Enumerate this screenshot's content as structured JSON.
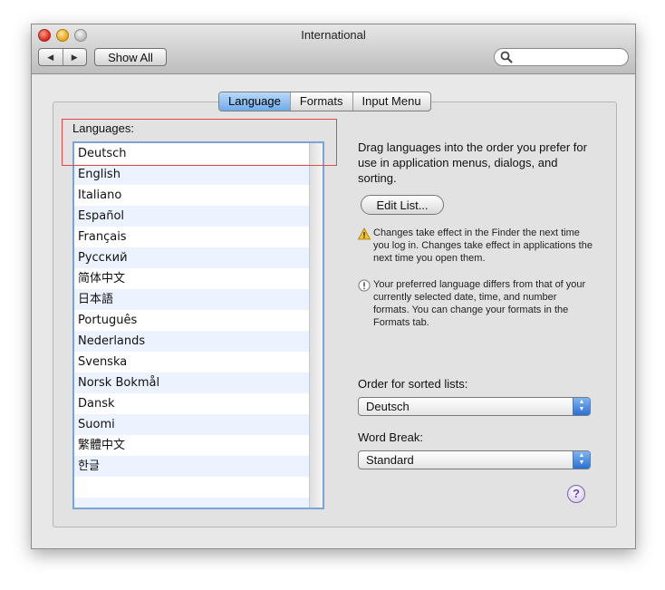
{
  "window": {
    "title": "International"
  },
  "toolbar": {
    "back_label": "◀",
    "forward_label": "▶",
    "show_all_label": "Show All",
    "search_value": "",
    "search_placeholder": ""
  },
  "tabs": [
    {
      "label": "Language",
      "active": true
    },
    {
      "label": "Formats",
      "active": false
    },
    {
      "label": "Input Menu",
      "active": false
    }
  ],
  "languages": {
    "label": "Languages:",
    "items": [
      "Deutsch",
      "English",
      "Italiano",
      "Español",
      "Français",
      "Русский",
      "简体中文",
      "日本語",
      "Português",
      "Nederlands",
      "Svenska",
      "Norsk Bokmål",
      "Dansk",
      "Suomi",
      "繁體中文",
      "한글"
    ]
  },
  "instructions": "Drag languages into the order you prefer for use in application menus, dialogs, and sorting.",
  "edit_list_label": "Edit List...",
  "notes": {
    "warning": "Changes take effect in the Finder the next time you log in. Changes take effect in applications the next time you open them.",
    "info": "Your preferred language differs from that of your currently selected date, time, and number formats. You can change your formats in the Formats tab."
  },
  "sort_order": {
    "label": "Order for sorted lists:",
    "value": "Deutsch"
  },
  "word_break": {
    "label": "Word Break:",
    "value": "Standard"
  },
  "help_label": "?",
  "colors": {
    "accent": "#6fabe9",
    "highlight_box": "#e0484c",
    "list_alt_row": "#edf3fe"
  },
  "icons": {
    "warning": "warning-triangle-icon",
    "info": "exclamation-circle-icon",
    "search": "magnifier-icon"
  }
}
